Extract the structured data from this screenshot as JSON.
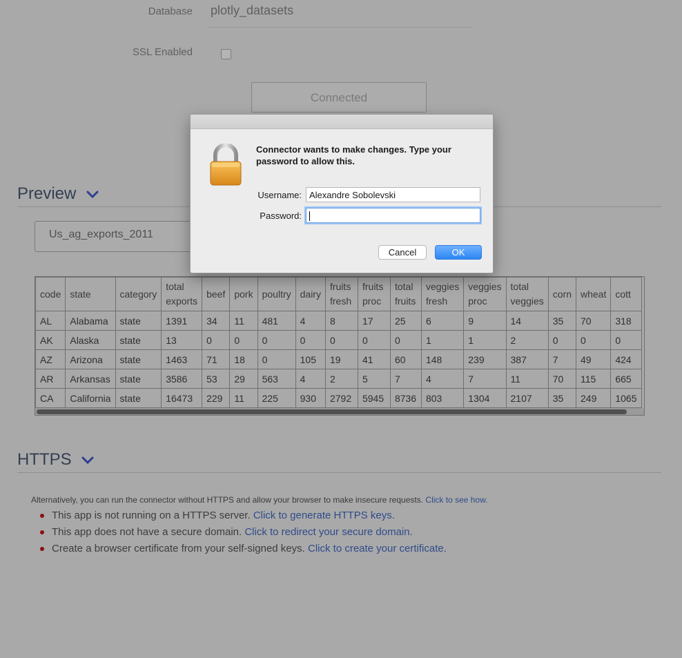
{
  "form": {
    "database_label": "Database",
    "database_value": "plotly_datasets",
    "ssl_label": "SSL Enabled",
    "connected_label": "Connected"
  },
  "preview": {
    "title": "Preview",
    "selected_table": "Us_ag_exports_2011",
    "columns": [
      "code",
      "state",
      "category",
      "total exports",
      "beef",
      "pork",
      "poultry",
      "dairy",
      "fruits fresh",
      "fruits proc",
      "total fruits",
      "veggies fresh",
      "veggies proc",
      "total veggies",
      "corn",
      "wheat",
      "cott"
    ],
    "rows": [
      [
        "AL",
        "Alabama",
        "state",
        "1391",
        "34",
        "11",
        "481",
        "4",
        "8",
        "17",
        "25",
        "6",
        "9",
        "14",
        "35",
        "70",
        "318"
      ],
      [
        "AK",
        "Alaska",
        "state",
        "13",
        "0",
        "0",
        "0",
        "0",
        "0",
        "0",
        "0",
        "1",
        "1",
        "2",
        "0",
        "0",
        "0"
      ],
      [
        "AZ",
        "Arizona",
        "state",
        "1463",
        "71",
        "18",
        "0",
        "105",
        "19",
        "41",
        "60",
        "148",
        "239",
        "387",
        "7",
        "49",
        "424"
      ],
      [
        "AR",
        "Arkansas",
        "state",
        "3586",
        "53",
        "29",
        "563",
        "4",
        "2",
        "5",
        "7",
        "4",
        "7",
        "11",
        "70",
        "115",
        "665"
      ],
      [
        "CA",
        "California",
        "state",
        "16473",
        "229",
        "11",
        "225",
        "930",
        "2792",
        "5945",
        "8736",
        "803",
        "1304",
        "2107",
        "35",
        "249",
        "1065"
      ]
    ]
  },
  "https": {
    "title": "HTTPS",
    "note": "Alternatively, you can run the connector without HTTPS and allow your browser to make insecure requests.",
    "note_link": "Click to see how.",
    "items": [
      {
        "text": "This app is not running on a HTTPS server.",
        "link": "Click to generate HTTPS keys."
      },
      {
        "text": "This app does not have a secure domain.",
        "link": "Click to redirect your secure domain."
      },
      {
        "text": "Create a browser certificate from your self-signed keys.",
        "link": "Click to create your certificate."
      }
    ]
  },
  "dialog": {
    "message": "Connector wants to make changes. Type your password to allow this.",
    "username_label": "Username:",
    "username_value": "Alexandre Sobolevski",
    "password_label": "Password:",
    "password_value": "",
    "cancel_label": "Cancel",
    "ok_label": "OK"
  },
  "colors": {
    "overlay_bg": "#a9a9a9",
    "dialog_bg": "#ececec",
    "ok_button": "#2d86f3",
    "link": "#2f4b8a",
    "bullet": "#8f0f0f"
  },
  "icons": {
    "lock": "lock-icon",
    "chevron": "chevron-down-icon"
  }
}
